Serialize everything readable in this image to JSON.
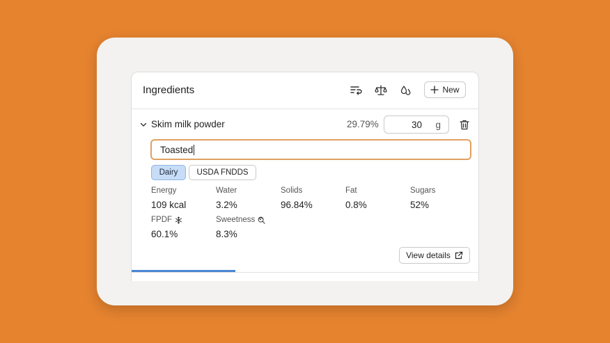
{
  "panel": {
    "title": "Ingredients",
    "new_button_label": "New",
    "header_icons": [
      "sort-icon",
      "scale-icon",
      "drops-icon"
    ]
  },
  "ingredient": {
    "name": "Skim milk powder",
    "percent": "29.79%",
    "quantity": "30",
    "unit": "g",
    "note_value": "Toasted",
    "tags": [
      {
        "label": "Dairy",
        "selected": true
      },
      {
        "label": "USDA FNDDS",
        "selected": false
      }
    ],
    "stats": [
      {
        "label": "Energy",
        "value": "109 kcal"
      },
      {
        "label": "Water",
        "value": "3.2%"
      },
      {
        "label": "Solids",
        "value": "96.84%"
      },
      {
        "label": "Fat",
        "value": "0.8%"
      },
      {
        "label": "Sugars",
        "value": "52%"
      },
      {
        "label": "FPDF",
        "value": "60.1%",
        "icon": "snowflake-icon"
      },
      {
        "label": "Sweetness",
        "value": "8.3%",
        "icon": "lollipop-icon"
      }
    ],
    "view_details_label": "View details"
  },
  "progress": 0.3,
  "colors": {
    "background": "#E5832F",
    "accent": "#4A86D4",
    "focus_border": "#E0A15F",
    "tag_selected": "#C7DCF7"
  }
}
